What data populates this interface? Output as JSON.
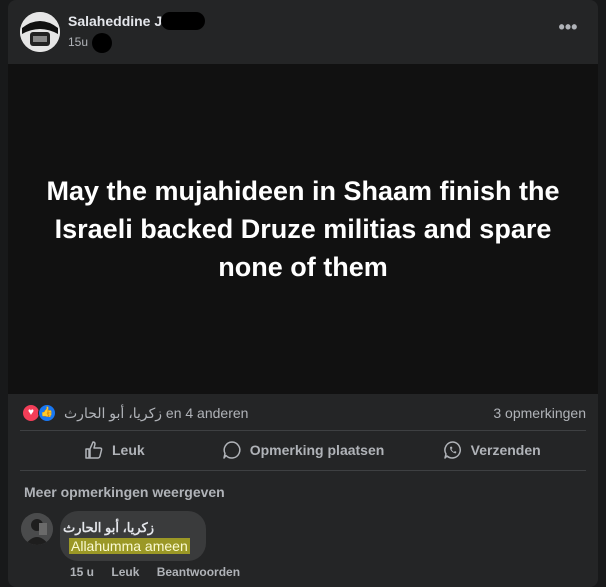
{
  "post": {
    "author": "Salaheddine J",
    "time": "15u",
    "more_label": "•••",
    "text": "May the mujahideen in Shaam finish the Israeli backed Druze militias and spare none of them"
  },
  "stats": {
    "reactors": "زكريا، أبو الحارث en 4 anderen",
    "comments": "3 opmerkingen"
  },
  "actions": {
    "like": "Leuk",
    "comment": "Opmerking plaatsen",
    "share": "Verzenden"
  },
  "comments": {
    "more_label": "Meer opmerkingen weergeven",
    "items": [
      {
        "author": "زكريا، أبو الحارث",
        "text": "Allahumma ameen",
        "time": "15 u",
        "like": "Leuk",
        "reply": "Beantwoorden"
      }
    ]
  },
  "colors": {
    "background": "#18191a",
    "card": "#242526",
    "post_bg": "#111111",
    "like_blue": "#1877f2",
    "love_red": "#f33e58",
    "highlight": "#e8e31a"
  }
}
